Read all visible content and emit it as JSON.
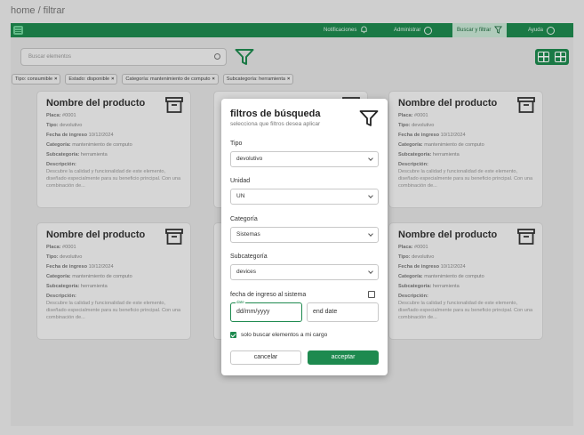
{
  "breadcrumb": "home / filtrar",
  "nav": {
    "notifications": "Notificaciones",
    "admin": "Administrar",
    "search_filter": "Buscar y filtrar",
    "help": "Ayuda"
  },
  "search": {
    "placeholder": "Buscar elementos"
  },
  "chips": [
    "Tipo: consumible",
    "Estado: disponible",
    "Categoría: mantenimiento de computo",
    "Subcategoría: herramienta"
  ],
  "chip_close": "×",
  "card": {
    "title": "Nombre del producto",
    "plate_label": "Placa:",
    "plate_value": "#0001",
    "type_label": "Tipo:",
    "type_value": "devolutivo",
    "date_label": "Fecha de ingreso",
    "date_value": "10/12/2024",
    "category_label": "Categoría:",
    "category_value": "mantenimiento de computo",
    "subcategory_label": "Subcategoría:",
    "subcategory_value": "herramienta",
    "desc_label": "Descripción:",
    "desc_text": "Descubre la calidad y funcionalidad de este elemento, diseñado especialmente para su beneficio principal. Con una combinación de..."
  },
  "modal": {
    "title": "filtros de búsqueda",
    "subtitle": "selecciona que filtros desea aplicar",
    "tipo_label": "Tipo",
    "tipo_value": "devolutivo",
    "unidad_label": "Unidad",
    "unidad_value": "UN",
    "categoria_label": "Categoría",
    "categoria_value": "Sistemas",
    "subcategoria_label": "Subcategoría",
    "subcategoria_value": "devices",
    "fecha_label": "fecha de ingreso al sistema",
    "date_tag": "date",
    "start_date": "dd/mm/yyyy",
    "end_date": "end date",
    "checkbox_label": "solo buscar elementos a mi cargo",
    "cancel": "cancelar",
    "accept": "acceptar"
  },
  "colors": {
    "brand": "#1e8a4f",
    "brand_light": "#c9e8d5"
  }
}
